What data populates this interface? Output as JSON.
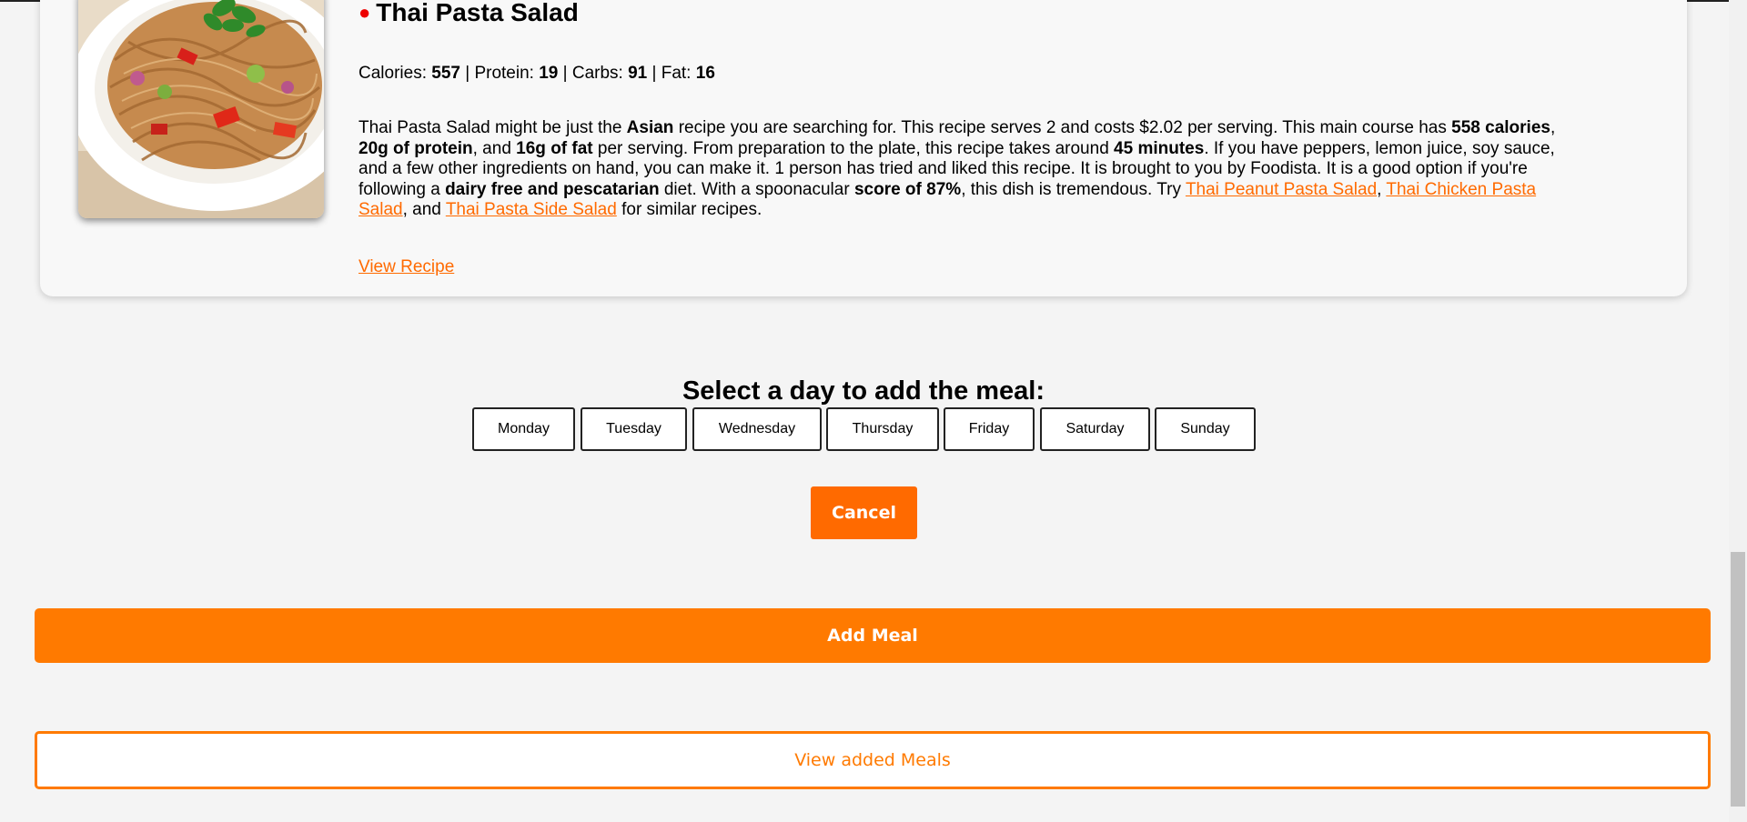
{
  "recipe": {
    "title_marker": "●",
    "title": "Thai Pasta Salad",
    "nutrition": {
      "calories_label": "Calories: ",
      "calories": "557",
      "protein_label": " | Protein: ",
      "protein": "19",
      "carbs_label": " | Carbs: ",
      "carbs": "91",
      "fat_label": " | Fat: ",
      "fat": "16"
    },
    "summary": {
      "t1": "Thai Pasta Salad might be just the ",
      "b1": "Asian",
      "t2": " recipe you are searching for. This recipe serves 2 and costs $2.02 per serving. This main course has ",
      "b2": "558 calories",
      "t3": ", ",
      "b3": "20g of protein",
      "t4": ", and ",
      "b4": "16g of fat",
      "t5": " per serving. From preparation to the plate, this recipe takes around ",
      "b5": "45 minutes",
      "t6": ". If you have peppers, lemon juice, soy sauce, and a few other ingredients on hand, you can make it. 1 person has tried and liked this recipe. It is brought to you by Foodista. It is a good option if you're following a ",
      "b6": "dairy free and pescatarian",
      "t7": " diet. With a spoonacular ",
      "b7": "score of 87%",
      "t8": ", this dish is tremendous. Try ",
      "link1": "Thai Peanut Pasta Salad",
      "t9": ", ",
      "link2": "Thai Chicken Pasta Salad",
      "t10": ", and ",
      "link3": "Thai Pasta Side Salad",
      "t11": " for similar recipes."
    },
    "view_recipe_label": "View Recipe"
  },
  "day_picker": {
    "heading": "Select a day to add the meal:",
    "days": [
      "Monday",
      "Tuesday",
      "Wednesday",
      "Thursday",
      "Friday",
      "Saturday",
      "Sunday"
    ],
    "cancel_label": "Cancel"
  },
  "actions": {
    "add_meal_label": "Add Meal",
    "view_added_meals_label": "View added Meals"
  },
  "colors": {
    "accent": "#ff7a00",
    "link": "#ff6a00",
    "title_marker": "#ee0000",
    "background": "#f4f4f4",
    "card": "#f8f8f8"
  }
}
